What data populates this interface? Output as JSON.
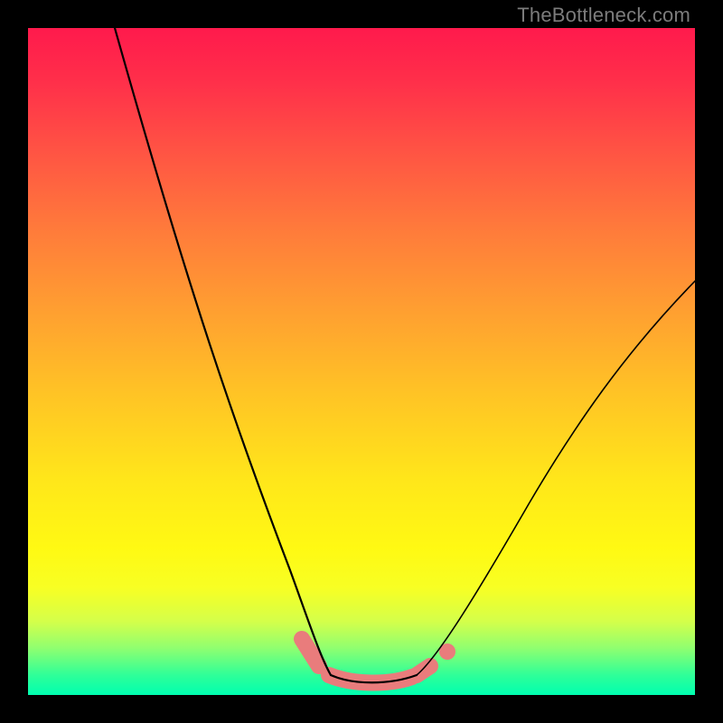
{
  "watermark": "TheBottleneck.com",
  "chart_data": {
    "type": "line",
    "title": "",
    "xlabel": "",
    "ylabel": "",
    "xlim": [
      0,
      100
    ],
    "ylim": [
      0,
      100
    ],
    "grid": false,
    "legend": false,
    "series": [
      {
        "name": "curve-left",
        "x": [
          14,
          18,
          22,
          26,
          30,
          34,
          38,
          42,
          45
        ],
        "values": [
          100,
          87,
          73,
          59,
          45,
          31,
          17,
          6,
          2
        ]
      },
      {
        "name": "curve-flat",
        "x": [
          45,
          48,
          52,
          56,
          60
        ],
        "values": [
          2,
          1,
          1,
          1,
          2
        ]
      },
      {
        "name": "curve-right",
        "x": [
          60,
          64,
          70,
          78,
          86,
          94,
          100
        ],
        "values": [
          2,
          6,
          18,
          32,
          44,
          55,
          62
        ]
      }
    ],
    "highlighted_regions": [
      {
        "name": "left-highlight",
        "x_start": 42,
        "x_end": 46
      },
      {
        "name": "flat-highlight",
        "x_start": 46,
        "x_end": 58
      },
      {
        "name": "right-highlight",
        "x_start": 58,
        "x_end": 60
      }
    ],
    "highlighted_points": [
      {
        "name": "right-dot",
        "x": 62,
        "y": 5
      }
    ]
  },
  "colors": {
    "curve": "#000000",
    "highlight": "#e97c7c",
    "gradient_top": "#ff1a4c",
    "gradient_bottom": "#00ffb0",
    "frame": "#000000",
    "watermark": "#7c7c7c"
  }
}
